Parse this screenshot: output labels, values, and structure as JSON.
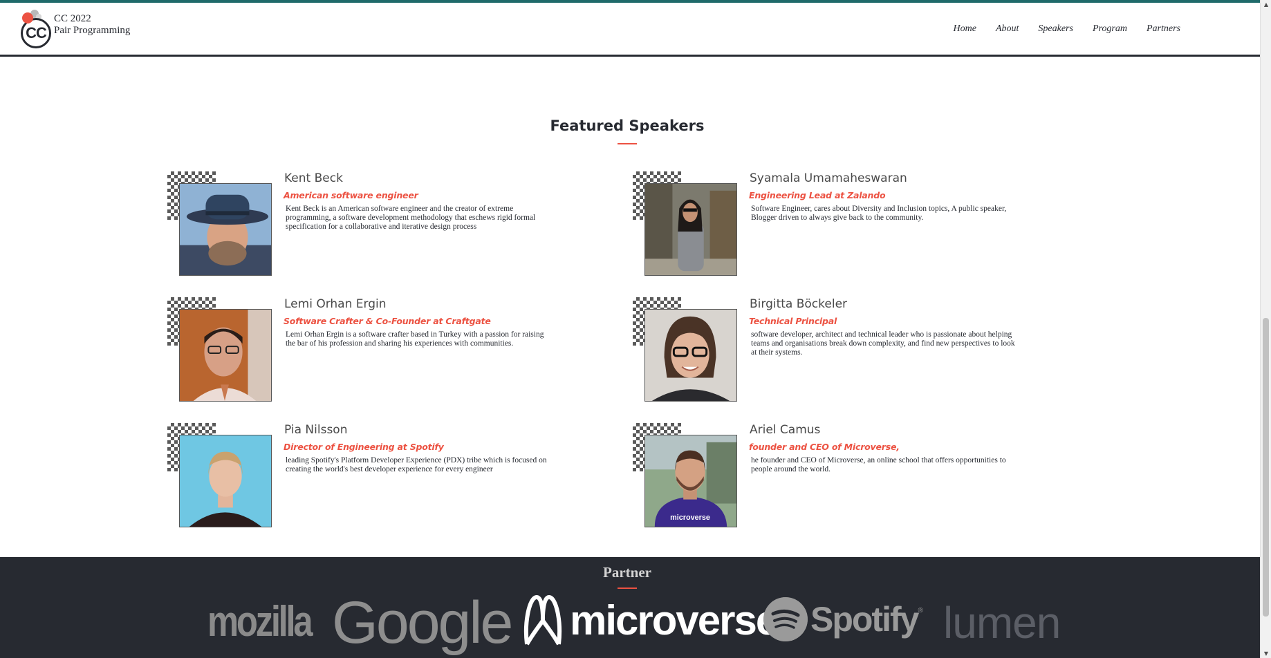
{
  "header": {
    "logo_text": "CC",
    "brand_line1": "CC 2022",
    "brand_line2": "Pair Programming",
    "nav": [
      "Home",
      "About",
      "Speakers",
      "Program",
      "Partners"
    ]
  },
  "speakers_section": {
    "title": "Featured Speakers",
    "speakers": [
      {
        "name": "Kent Beck",
        "role": "American software engineer",
        "bio": "Kent Beck is an American software engineer and the creator of extreme programming, a software development methodology that eschews rigid formal specification for a collaborative and iterative design process"
      },
      {
        "name": "Syamala Umamaheswaran",
        "role": "Engineering Lead at Zalando",
        "bio": "Software Engineer, cares about Diversity and Inclusion topics, A public speaker, Blogger driven to always give back to the community."
      },
      {
        "name": "Lemi Orhan Ergin",
        "role": "Software Crafter & Co-Founder at Craftgate",
        "bio": "Lemi Orhan Ergin is a software crafter based in Turkey with a passion for raising the bar of his profession and sharing his experiences with communities."
      },
      {
        "name": "Birgitta Böckeler",
        "role": "Technical Principal",
        "bio": "software developer, architect and technical leader who is passionate about helping teams and organisations break down complexity, and find new perspectives to look at their systems."
      },
      {
        "name": "Pia Nilsson",
        "role": "Director of Engineering at Spotify",
        "bio": "leading Spotify's Platform Developer Experience (PDX) tribe which is focused on creating the world's best developer experience for every engineer"
      },
      {
        "name": "Ariel Camus",
        "role": "founder and CEO of Microverse,",
        "bio": "he founder and CEO of Microverse, an online school that offers opportunities to people around the world.",
        "shirt_text": "microverse"
      }
    ]
  },
  "partners_section": {
    "title": "Partner",
    "logos": [
      "mozilla",
      "Google",
      "microverse",
      "Spotify",
      "lumen"
    ],
    "registered_mark": "®"
  },
  "colors": {
    "accent": "#ec5242",
    "dark": "#272a31",
    "topline": "#1f6a6a"
  }
}
